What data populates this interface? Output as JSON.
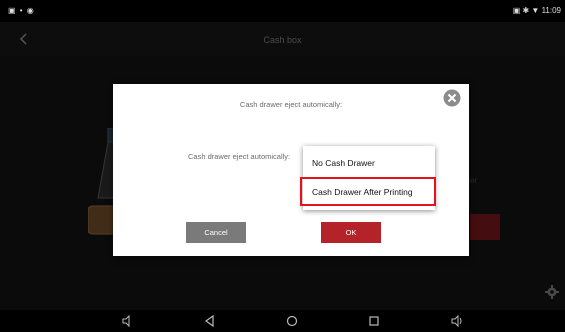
{
  "status_bar": {
    "time": "11:09"
  },
  "app": {
    "title": "Cash box"
  },
  "dialog": {
    "title": "Cash drawer eject automically:",
    "field_label": "Cash drawer eject automically:",
    "cancel_label": "Cancel",
    "ok_label": "OK"
  },
  "dropdown": {
    "options": [
      "No Cash Drawer",
      "Cash Drawer After Printing"
    ],
    "highlighted_option": "Cash Drawer After Printing"
  },
  "colors": {
    "ok_button": "#b5232a",
    "cancel_button": "#7a7a7a",
    "highlight_box": "#e0141c"
  },
  "icons": [
    "back-arrow-icon",
    "close-icon",
    "gear-icon",
    "volume-down-icon",
    "back-nav-icon",
    "home-nav-icon",
    "recents-nav-icon",
    "volume-up-icon"
  ]
}
